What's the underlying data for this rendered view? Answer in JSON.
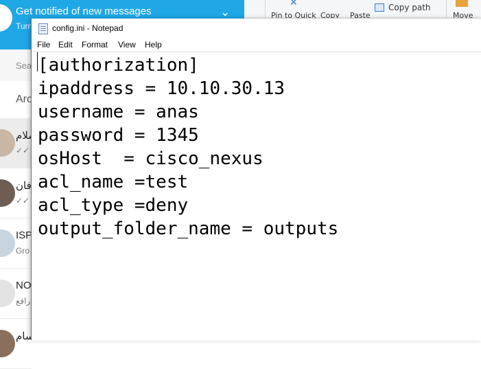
{
  "chat_app": {
    "banner": {
      "title": "Get notified of new messages",
      "subtitle": "Turn"
    },
    "search": {
      "placeholder": "Sea"
    },
    "archived": {
      "label": "Arc"
    },
    "chats": [
      {
        "name": "سلام",
        "preview": "✓✓",
        "avatar_color": "#c9b6a4"
      },
      {
        "name": "فان",
        "preview": "✓✓",
        "avatar_color": "#6d5d52"
      },
      {
        "name": "ISP",
        "preview": "Gro",
        "avatar_color": "#c8d4de"
      },
      {
        "name": "NO",
        "preview": "رافع",
        "avatar_color": "#e3e3e3"
      },
      {
        "name": "سام",
        "preview": "",
        "avatar_color": "#8a6f5c"
      }
    ]
  },
  "explorer_ribbon": {
    "pin_label": "Pin to Quick",
    "copy_label": "Copy",
    "paste_label": "Paste",
    "copy_path_label": "Copy path",
    "move_label": "Move"
  },
  "notepad": {
    "title": "config.ini - Notepad",
    "menu": [
      "File",
      "Edit",
      "Format",
      "View",
      "Help"
    ],
    "content_lines": [
      "[authorization]",
      "ipaddress = 10.10.30.13",
      "username = anas",
      "password = 1345",
      "osHost  = cisco_nexus",
      "acl_name =test",
      "acl_type =deny",
      "output_folder_name = outputs"
    ]
  },
  "colors": {
    "banner_blue": "#1fa7e6",
    "explorer_icon_blue": "#3a7bd5",
    "explorer_icon_orange": "#e8a33c"
  }
}
